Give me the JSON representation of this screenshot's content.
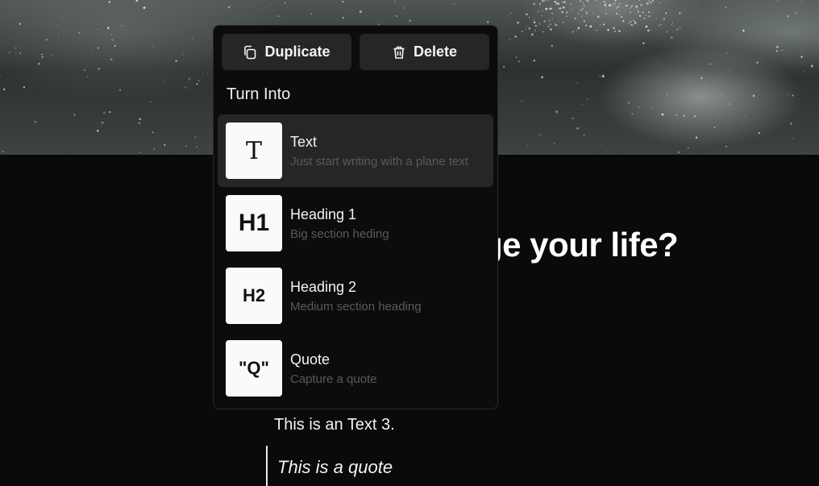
{
  "page": {
    "headline_fragment": "ge your life?",
    "paragraph": "This is an Text 3.",
    "quote": "This is a quote"
  },
  "menu": {
    "duplicate_label": "Duplicate",
    "delete_label": "Delete",
    "section_label": "Turn Into",
    "items": [
      {
        "glyph": "T",
        "title": "Text",
        "description": "Just start writing with a plane text"
      },
      {
        "glyph": "H1",
        "title": "Heading 1",
        "description": "Big section heding"
      },
      {
        "glyph": "H2",
        "title": "Heading 2",
        "description": "Medium section heading"
      },
      {
        "glyph": "\"Q\"",
        "title": "Quote",
        "description": "Capture a quote"
      }
    ]
  },
  "colors": {
    "background": "#0a0a0a",
    "menu_background": "#0c0c0c",
    "button_background": "#262626",
    "tile_background": "#fafafa",
    "description_text": "#5a5a5a"
  },
  "icons": {
    "duplicate": "copy-icon",
    "delete": "trash-icon"
  }
}
